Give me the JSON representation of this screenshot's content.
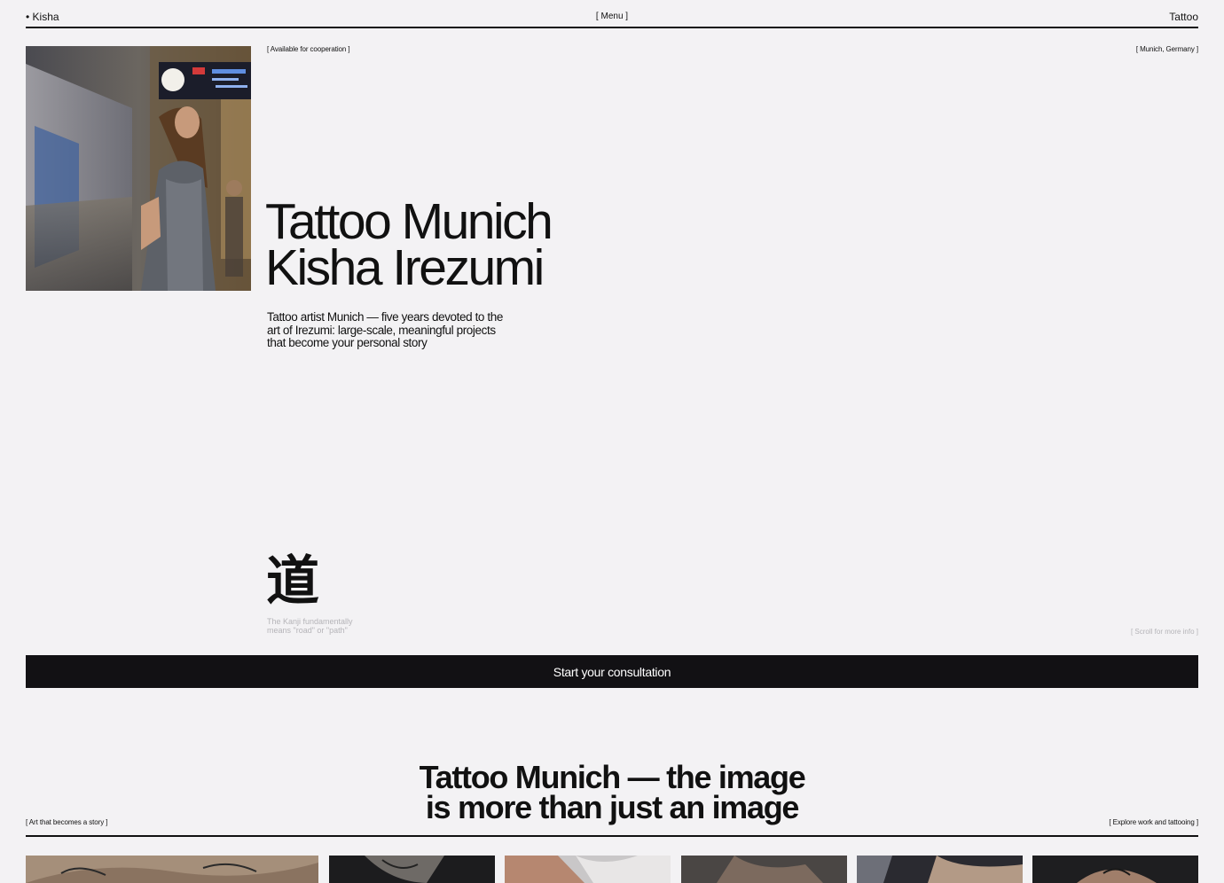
{
  "nav": {
    "brand": "• Kisha",
    "menu": "[ Menu ]",
    "right_link": "Tattoo"
  },
  "hero": {
    "availability": "[ Available for cooperation ]",
    "location": "[ Munich, Germany ]",
    "title_line1": "Tattoo Munich",
    "title_line2": "Kisha Irezumi",
    "description": "Tattoo artist Munich — five years devoted to the art of Irezumi: large-scale, meaningful projects that become your personal story",
    "kanji": "道",
    "kanji_caption": "The Kanji fundamentally means \"road\" or \"path\"",
    "scroll_hint": "[ Scroll for more info ]",
    "cta_label": "Start your consultation"
  },
  "section": {
    "title_line1": "Tattoo Munich — the image",
    "title_line2": "is more than just an image",
    "left_tag": "[ Art that becomes a story ]",
    "right_tag": "[ Explore work and tattooing ]"
  },
  "colors": {
    "background": "#f3f2f4",
    "text": "#111111",
    "cta_background": "#121114",
    "muted": "#b5b4b8"
  }
}
